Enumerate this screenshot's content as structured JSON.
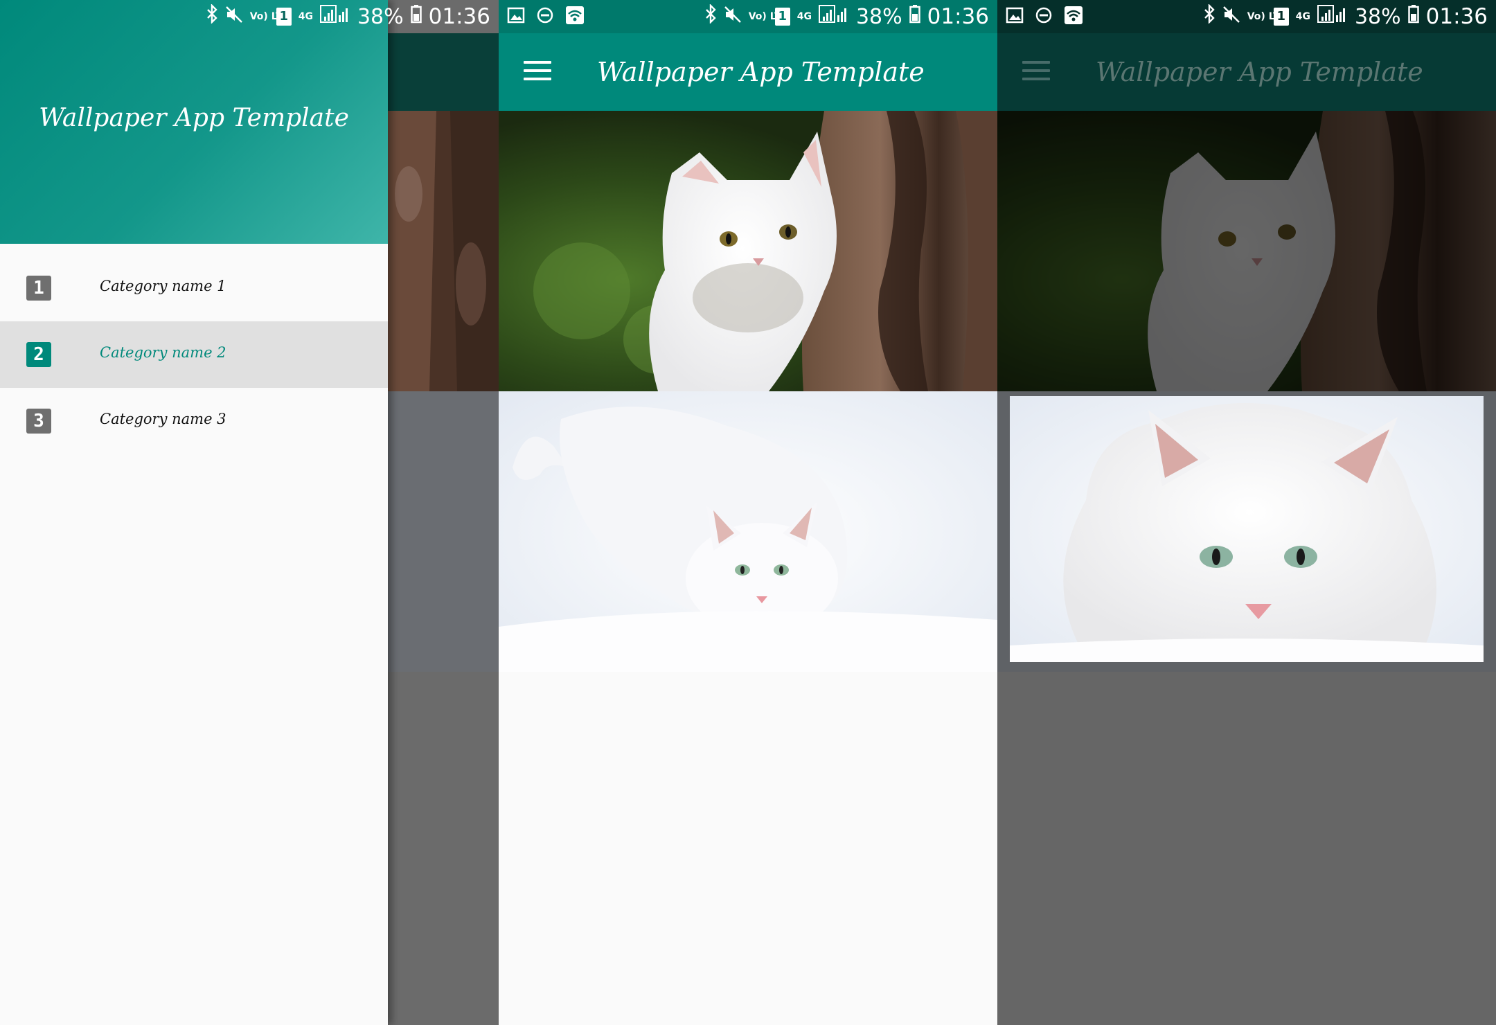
{
  "status_bar": {
    "battery": "38%",
    "time": "01:36",
    "network": "4G",
    "volte": "Vo) LTE",
    "sim": "1"
  },
  "app": {
    "title": "Wallpaper App Template"
  },
  "drawer": {
    "header_title": "Wallpaper App Template",
    "items": [
      {
        "num": "1",
        "label": "Category name 1",
        "selected": false
      },
      {
        "num": "2",
        "label": "Category name 2",
        "selected": true
      },
      {
        "num": "3",
        "label": "Category name 3",
        "selected": false
      }
    ]
  },
  "colors": {
    "primary": "#00897b",
    "primary_dark": "#00695c",
    "selected_bg": "#e0e0e0",
    "badge_gray": "#6f6f6f",
    "scrim": "#6b6b6b"
  },
  "wallpapers": [
    {
      "name": "cat-by-tree"
    },
    {
      "name": "white-cat-in-snow"
    }
  ]
}
